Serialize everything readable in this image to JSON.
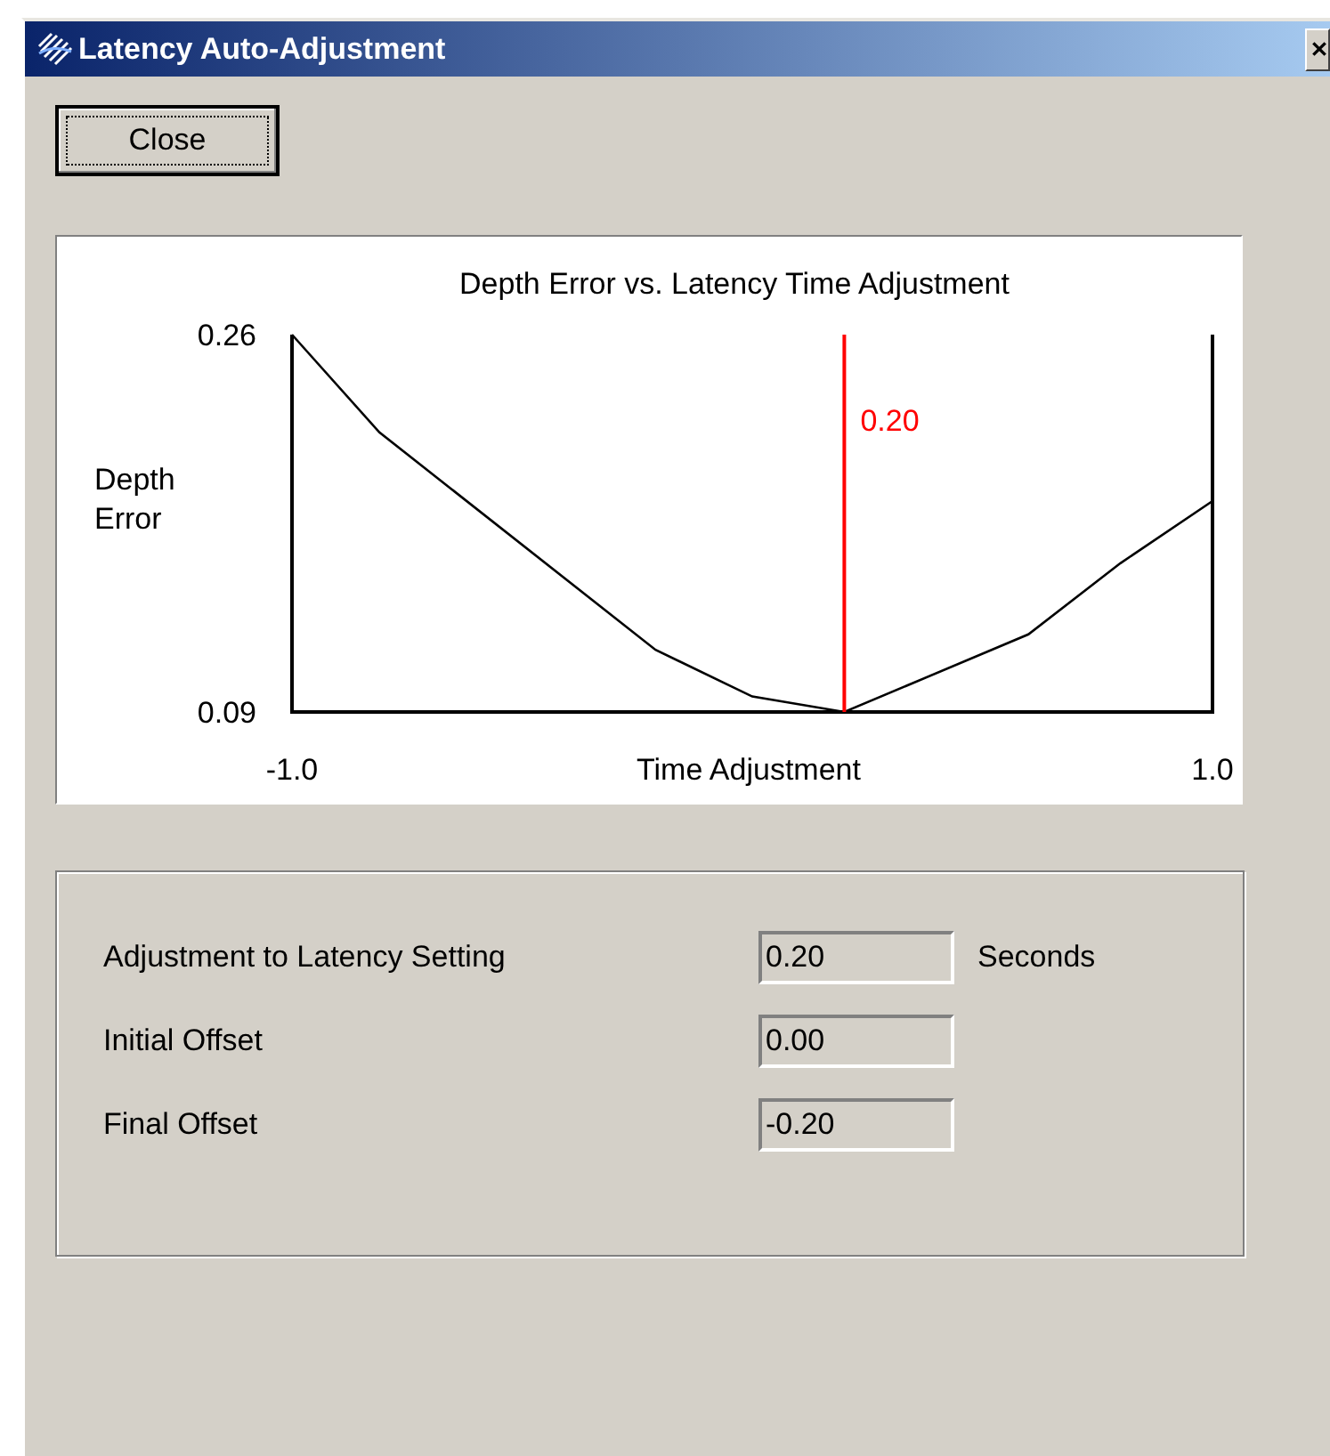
{
  "window": {
    "title": "Latency Auto-Adjustment"
  },
  "buttons": [
    {
      "label": "Close"
    }
  ],
  "chart": {
    "chart_data": {
      "type": "line",
      "title": "Depth Error vs. Latency Time Adjustment",
      "xlabel": "Time Adjustment",
      "ylabel": "Depth Error",
      "x": [
        -1.0,
        -0.81,
        -0.21,
        0.0,
        0.2,
        0.6,
        0.8,
        1.0
      ],
      "series": [
        {
          "color": "#000000",
          "values": [
            0.26,
            0.216,
            0.118,
            0.097,
            0.09,
            0.125,
            0.157,
            0.185
          ]
        }
      ],
      "xlim": [
        -1.0,
        1.0
      ],
      "ylim": [
        0.09,
        0.26
      ],
      "xticks": [
        {
          "value": -1.0,
          "label": "-1.0"
        },
        {
          "value": 1.0,
          "label": "1.0"
        }
      ],
      "yticks": [
        {
          "value": 0.26,
          "label": "0.26"
        },
        {
          "value": 0.09,
          "label": "0.09"
        }
      ],
      "ref_lines": [
        {
          "axis": "x",
          "value": 0.2,
          "label": "0.20",
          "color": "#ff0000"
        }
      ]
    }
  },
  "results": [
    {
      "label": "Adjustment to Latency Setting",
      "value": "0.20",
      "unit": "Seconds"
    },
    {
      "label": "Initial Offset",
      "value": "0.00"
    },
    {
      "label": "Final Offset",
      "value": "-0.20"
    }
  ]
}
